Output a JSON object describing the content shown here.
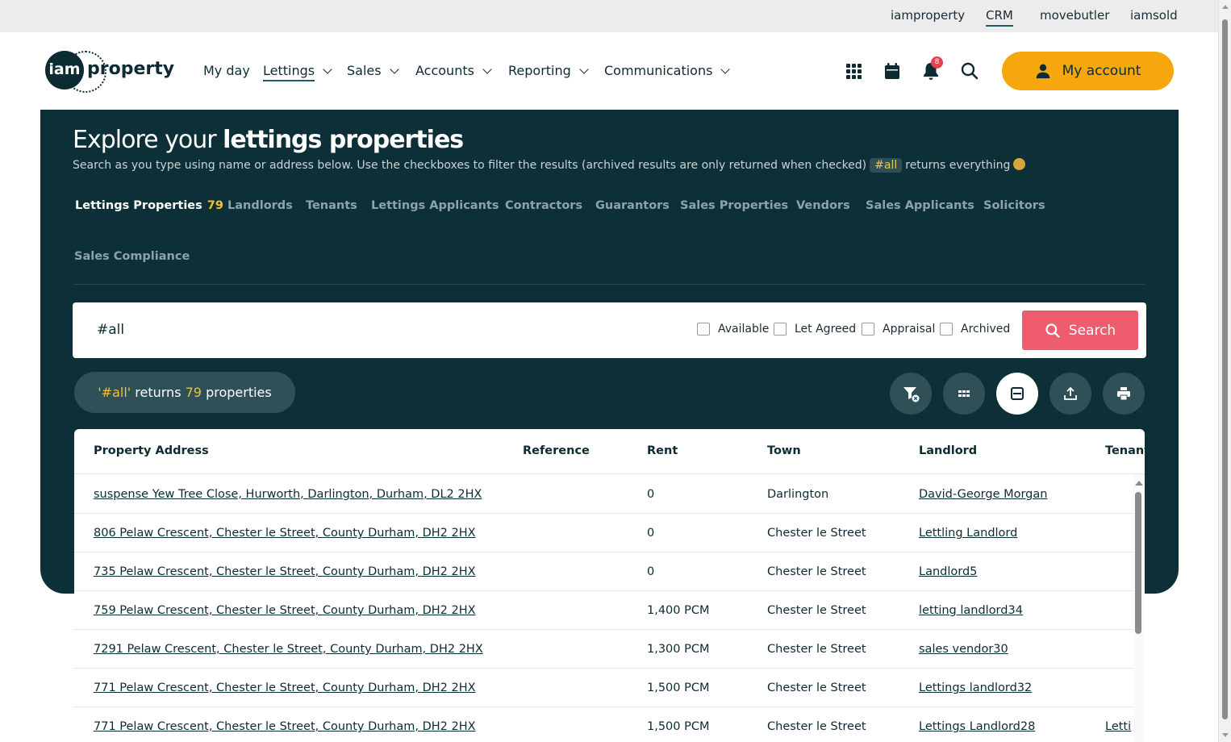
{
  "topbar": {
    "links": [
      "iamproperty",
      "CRM",
      "movebutler",
      "iamsold"
    ],
    "active": "CRM"
  },
  "logo": {
    "mark": "iam",
    "word": "property"
  },
  "nav": {
    "items": [
      {
        "label": "My day",
        "has_dropdown": false
      },
      {
        "label": "Lettings",
        "has_dropdown": true,
        "active": true
      },
      {
        "label": "Sales",
        "has_dropdown": true
      },
      {
        "label": "Accounts",
        "has_dropdown": true
      },
      {
        "label": "Reporting",
        "has_dropdown": true
      },
      {
        "label": "Communications",
        "has_dropdown": true
      }
    ],
    "icons": [
      "apps-grid-icon",
      "calendar-icon",
      "bell-icon",
      "search-icon"
    ],
    "notification_count": "8",
    "account_label": "My account"
  },
  "hero": {
    "title_regular": "Explore your ",
    "title_bold": "lettings properties",
    "subtitle_pre": "Search as you type using name or address below. Use the checkboxes to filter the results (archived results are only returned when checked)",
    "subtitle_tag": "#all",
    "subtitle_post": "returns everything",
    "tabs": [
      {
        "label": "Lettings Properties",
        "count": "79",
        "active": true
      },
      {
        "label": "Landlords"
      },
      {
        "label": "Tenants"
      },
      {
        "label": "Lettings Applicants"
      },
      {
        "label": "Contractors"
      },
      {
        "label": "Guarantors"
      },
      {
        "label": "Sales Properties"
      },
      {
        "label": "Vendors"
      },
      {
        "label": "Sales Applicants"
      },
      {
        "label": "Solicitors"
      },
      {
        "label": "Sales Compliance"
      }
    ]
  },
  "search": {
    "value": "#all",
    "filters": [
      "Available",
      "Let Agreed",
      "Appraisal",
      "Archived"
    ],
    "button_label": "Search"
  },
  "results": {
    "query": "'#all'",
    "returns": "returns",
    "count": "79",
    "noun": "properties"
  },
  "toolbar_icons": [
    "filter-clear-icon",
    "grid-view-icon",
    "list-view-icon",
    "export-icon",
    "print-icon"
  ],
  "table": {
    "columns": [
      "Property Address",
      "Reference",
      "Rent",
      "Town",
      "Landlord",
      "Tenant"
    ],
    "rows": [
      {
        "address": "suspense Yew Tree Close, Hurworth, Darlington, Durham, DL2 2HX",
        "reference": "",
        "rent": "0",
        "town": "Darlington",
        "landlord": "David-George Morgan",
        "tenant": ""
      },
      {
        "address": "806 Pelaw Crescent, Chester le Street, County Durham, DH2 2HX",
        "reference": "",
        "rent": "0",
        "town": "Chester le Street",
        "landlord": "Lettling Landlord",
        "tenant": ""
      },
      {
        "address": "735 Pelaw Crescent, Chester le Street, County Durham, DH2 2HX",
        "reference": "",
        "rent": "0",
        "town": "Chester le Street",
        "landlord": "Landlord5",
        "tenant": ""
      },
      {
        "address": "759 Pelaw Crescent, Chester le Street, County Durham, DH2 2HX",
        "reference": "",
        "rent": "1,400 PCM",
        "town": "Chester le Street",
        "landlord": "letting landlord34",
        "tenant": ""
      },
      {
        "address": "7291 Pelaw Crescent, Chester le Street, County Durham, DH2 2HX",
        "reference": "",
        "rent": "1,300 PCM",
        "town": "Chester le Street",
        "landlord": "sales vendor30",
        "tenant": ""
      },
      {
        "address": "771 Pelaw Crescent, Chester le Street, County Durham, DH2 2HX",
        "reference": "",
        "rent": "1,500 PCM",
        "town": "Chester le Street",
        "landlord": "Lettings landlord32",
        "tenant": ""
      },
      {
        "address": "771 Pelaw Crescent, Chester le Street, County Durham, DH2 2HX",
        "reference": "",
        "rent": "1,500 PCM",
        "town": "Chester le Street",
        "landlord": "Lettings Landlord28",
        "tenant": "Letti"
      }
    ]
  },
  "colors": {
    "brand_dark": "#0d3038",
    "account_button": "#f5a70d",
    "search_button": "#ef5b6f",
    "accent_yellow": "#f5c02d"
  }
}
